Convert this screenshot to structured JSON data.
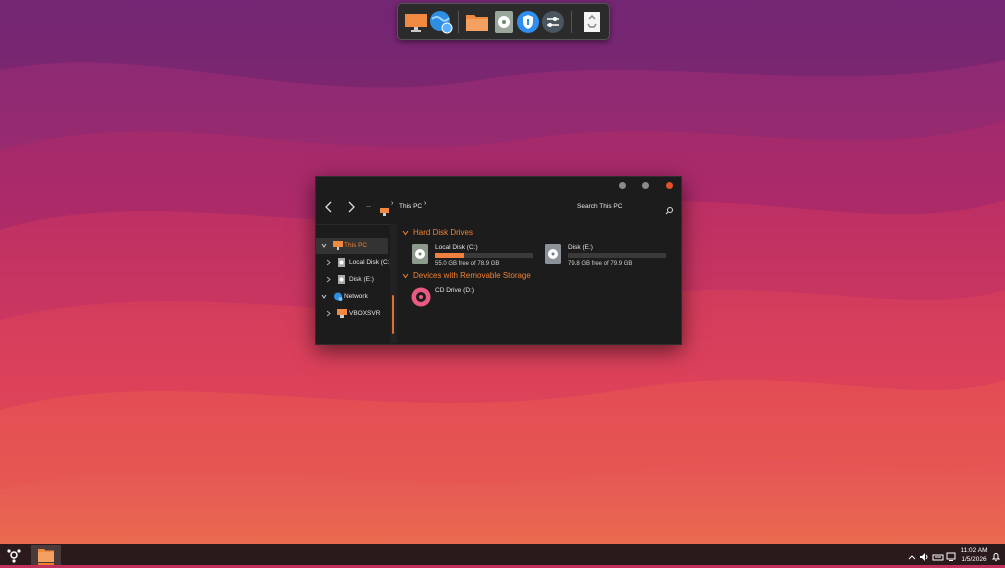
{
  "window": {
    "breadcrumb": [
      "This PC"
    ],
    "search_placeholder": "Search This PC"
  },
  "sidebar": {
    "items": [
      {
        "label": "This PC",
        "state": "expanded",
        "active": true
      },
      {
        "label": "Local Disk (C:)",
        "state": "collapsed"
      },
      {
        "label": "Disk (E:)",
        "state": "collapsed"
      },
      {
        "label": "Network",
        "state": "expanded"
      },
      {
        "label": "VBOXSVR",
        "state": "collapsed"
      }
    ]
  },
  "content": {
    "groups": [
      {
        "title": "Hard Disk Drives",
        "drives": [
          {
            "name": "Local Disk (C:)",
            "free_text": "55.0 GB free of 78.9 GB",
            "used_fraction": 0.3
          },
          {
            "name": "Disk (E:)",
            "free_text": "79.8 GB free of 79.9 GB",
            "used_fraction": 0.0
          }
        ]
      },
      {
        "title": "Devices with Removable Storage",
        "drives": [
          {
            "name": "CD Drive (D:)"
          }
        ]
      }
    ]
  },
  "taskbar": {
    "time": "11:02 AM",
    "date": "1/5/2026"
  },
  "colors": {
    "accent": "#f08030",
    "window_bg": "#1c1c1c",
    "taskbar_bg": "#2b1a1c"
  }
}
